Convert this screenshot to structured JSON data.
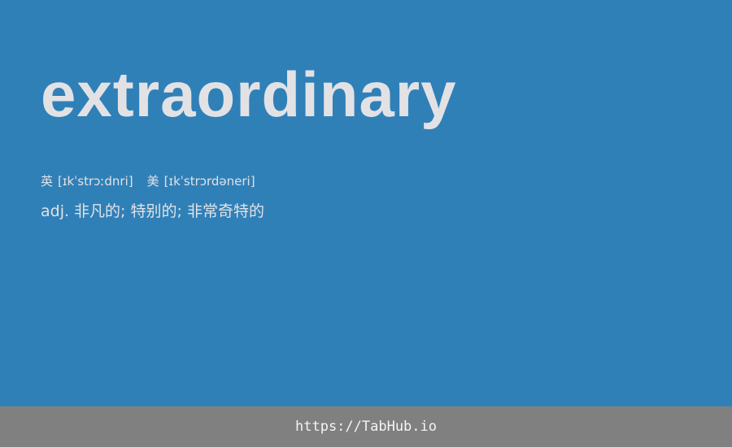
{
  "colors": {
    "background": "#3080b8",
    "text": "#e2e2e5",
    "footer_background": "#808080",
    "footer_text": "#f4f4f4"
  },
  "entry": {
    "word": "extraordinary",
    "phonetics": {
      "uk": {
        "label": "英",
        "ipa": "[ɪkˈstrɔːdnri]"
      },
      "us": {
        "label": "美",
        "ipa": "[ɪkˈstrɔrdəneri]"
      }
    },
    "definition": "adj. 非凡的; 特别的; 非常奇特的"
  },
  "footer": {
    "url": "https://TabHub.io"
  }
}
